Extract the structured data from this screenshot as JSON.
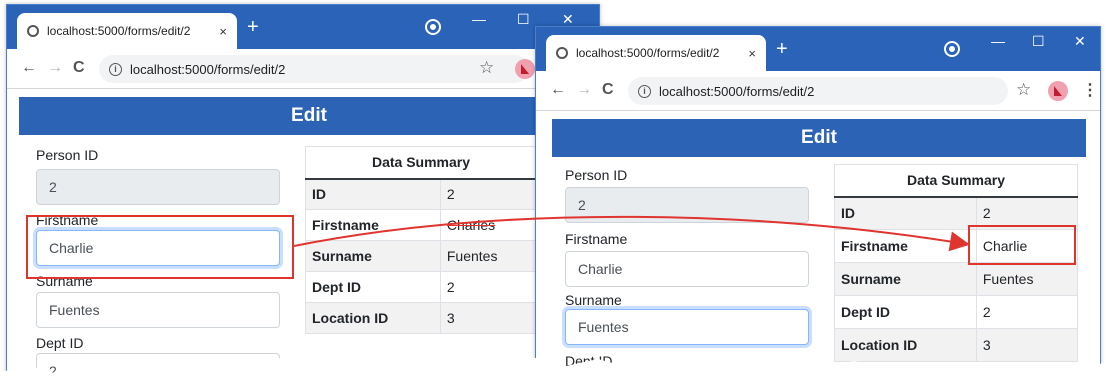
{
  "browser": {
    "tab_title": "localhost:5000/forms/edit/2",
    "close_glyph": "×",
    "new_tab_glyph": "+",
    "url": "localhost:5000/forms/edit/2",
    "controls": {
      "minimize": "—",
      "maximize": "☐",
      "close": "✕"
    },
    "nav": {
      "back": "←",
      "forward": "→",
      "reload": "C"
    },
    "info_glyph": "i",
    "star_glyph": "☆",
    "menu_glyph": "⋮"
  },
  "page": {
    "header": "Edit",
    "labels": {
      "person_id": "Person ID",
      "firstname": "Firstname",
      "surname": "Surname",
      "dept_id": "Dept ID"
    },
    "values": {
      "person_id": "2",
      "firstname": "Charlie",
      "surname": "Fuentes",
      "dept_id": "2"
    }
  },
  "summary": {
    "title": "Data Summary",
    "keys": [
      "ID",
      "Firstname",
      "Surname",
      "Dept ID",
      "Location ID"
    ],
    "before": [
      "2",
      "Charles",
      "Fuentes",
      "2",
      "3"
    ],
    "after": [
      "2",
      "Charlie",
      "Fuentes",
      "2",
      "3"
    ]
  },
  "colors": {
    "titlebar": "#2a63b8",
    "header": "#2c63b5",
    "highlight": "#e0342f"
  }
}
